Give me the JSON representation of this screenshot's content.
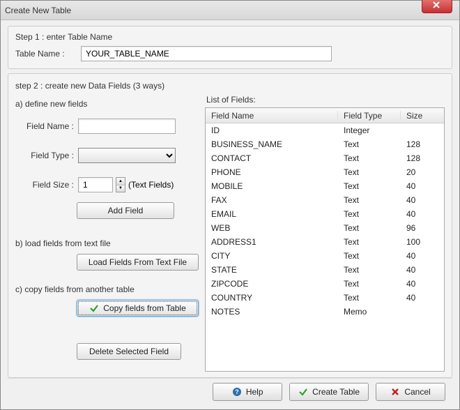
{
  "window": {
    "title": "Create New Table"
  },
  "step1": {
    "heading": "Step 1 : enter Table Name",
    "label": "Table Name :",
    "value": "YOUR_TABLE_NAME"
  },
  "step2": {
    "heading": "step 2 : create new Data Fields (3 ways)",
    "a_heading": "a) define new fields",
    "fieldname_label": "Field Name :",
    "fieldname_value": "",
    "fieldtype_label": "Field Type :",
    "fieldtype_value": "",
    "fieldsize_label": "Field Size :",
    "fieldsize_value": "1",
    "fieldsize_suffix": "(Text Fields)",
    "addfield_label": "Add Field",
    "b_heading": "b) load fields from text file",
    "loadfile_label": "Load Fields From Text File",
    "c_heading": "c) copy fields from another table",
    "copytable_label": "Copy fields from Table",
    "delete_label": "Delete Selected Field"
  },
  "fieldlist": {
    "label": "List of Fields:",
    "columns": {
      "name": "Field Name",
      "type": "Field Type",
      "size": "Size"
    },
    "rows": [
      {
        "name": "ID",
        "type": "Integer",
        "size": ""
      },
      {
        "name": "BUSINESS_NAME",
        "type": "Text",
        "size": "128"
      },
      {
        "name": "CONTACT",
        "type": "Text",
        "size": "128"
      },
      {
        "name": "PHONE",
        "type": "Text",
        "size": "20"
      },
      {
        "name": "MOBILE",
        "type": "Text",
        "size": "40"
      },
      {
        "name": "FAX",
        "type": "Text",
        "size": "40"
      },
      {
        "name": "EMAIL",
        "type": "Text",
        "size": "40"
      },
      {
        "name": "WEB",
        "type": "Text",
        "size": "96"
      },
      {
        "name": "ADDRESS1",
        "type": "Text",
        "size": "100"
      },
      {
        "name": "CITY",
        "type": "Text",
        "size": "40"
      },
      {
        "name": "STATE",
        "type": "Text",
        "size": "40"
      },
      {
        "name": "ZIPCODE",
        "type": "Text",
        "size": "40"
      },
      {
        "name": "COUNTRY",
        "type": "Text",
        "size": "40"
      },
      {
        "name": "NOTES",
        "type": "Memo",
        "size": ""
      }
    ]
  },
  "footer": {
    "help": "Help",
    "create": "Create Table",
    "cancel": "Cancel"
  },
  "icons": {
    "check_color": "#2e9e2e",
    "x_color": "#c02020",
    "help_color": "#2a6fb0"
  }
}
